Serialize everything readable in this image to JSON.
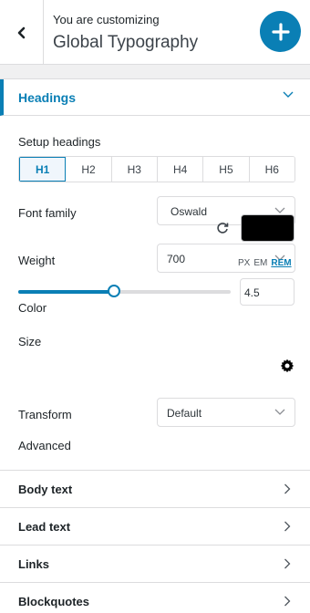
{
  "header": {
    "subtitle": "You are customizing",
    "title": "Global Typography"
  },
  "panel": {
    "section_title": "Headings",
    "setup_label": "Setup headings",
    "heading_levels": [
      "H1",
      "H2",
      "H3",
      "H4",
      "H5",
      "H6"
    ],
    "active_level": "H1",
    "font_family": {
      "label": "Font family",
      "value": "Oswald"
    },
    "weight": {
      "label": "Weight",
      "value": "700"
    },
    "color": {
      "label": "Color",
      "value": "#000000"
    },
    "size": {
      "label": "Size",
      "units": [
        "PX",
        "EM",
        "REM"
      ],
      "active_unit": "REM",
      "value": "4.5",
      "slider_fraction": 0.45
    },
    "transform": {
      "label": "Transform",
      "value": "Default"
    },
    "advanced_label": "Advanced"
  },
  "sections": [
    "Body text",
    "Lead text",
    "Links",
    "Blockquotes"
  ],
  "colors": {
    "accent": "#0a7fb5",
    "border": "#dcdcde",
    "panel_bg": "#f0f0f1"
  },
  "icons": [
    "back-chevron-icon",
    "plus-icon",
    "chevron-down-icon",
    "reset-icon",
    "gear-icon",
    "chevron-right-icon"
  ]
}
